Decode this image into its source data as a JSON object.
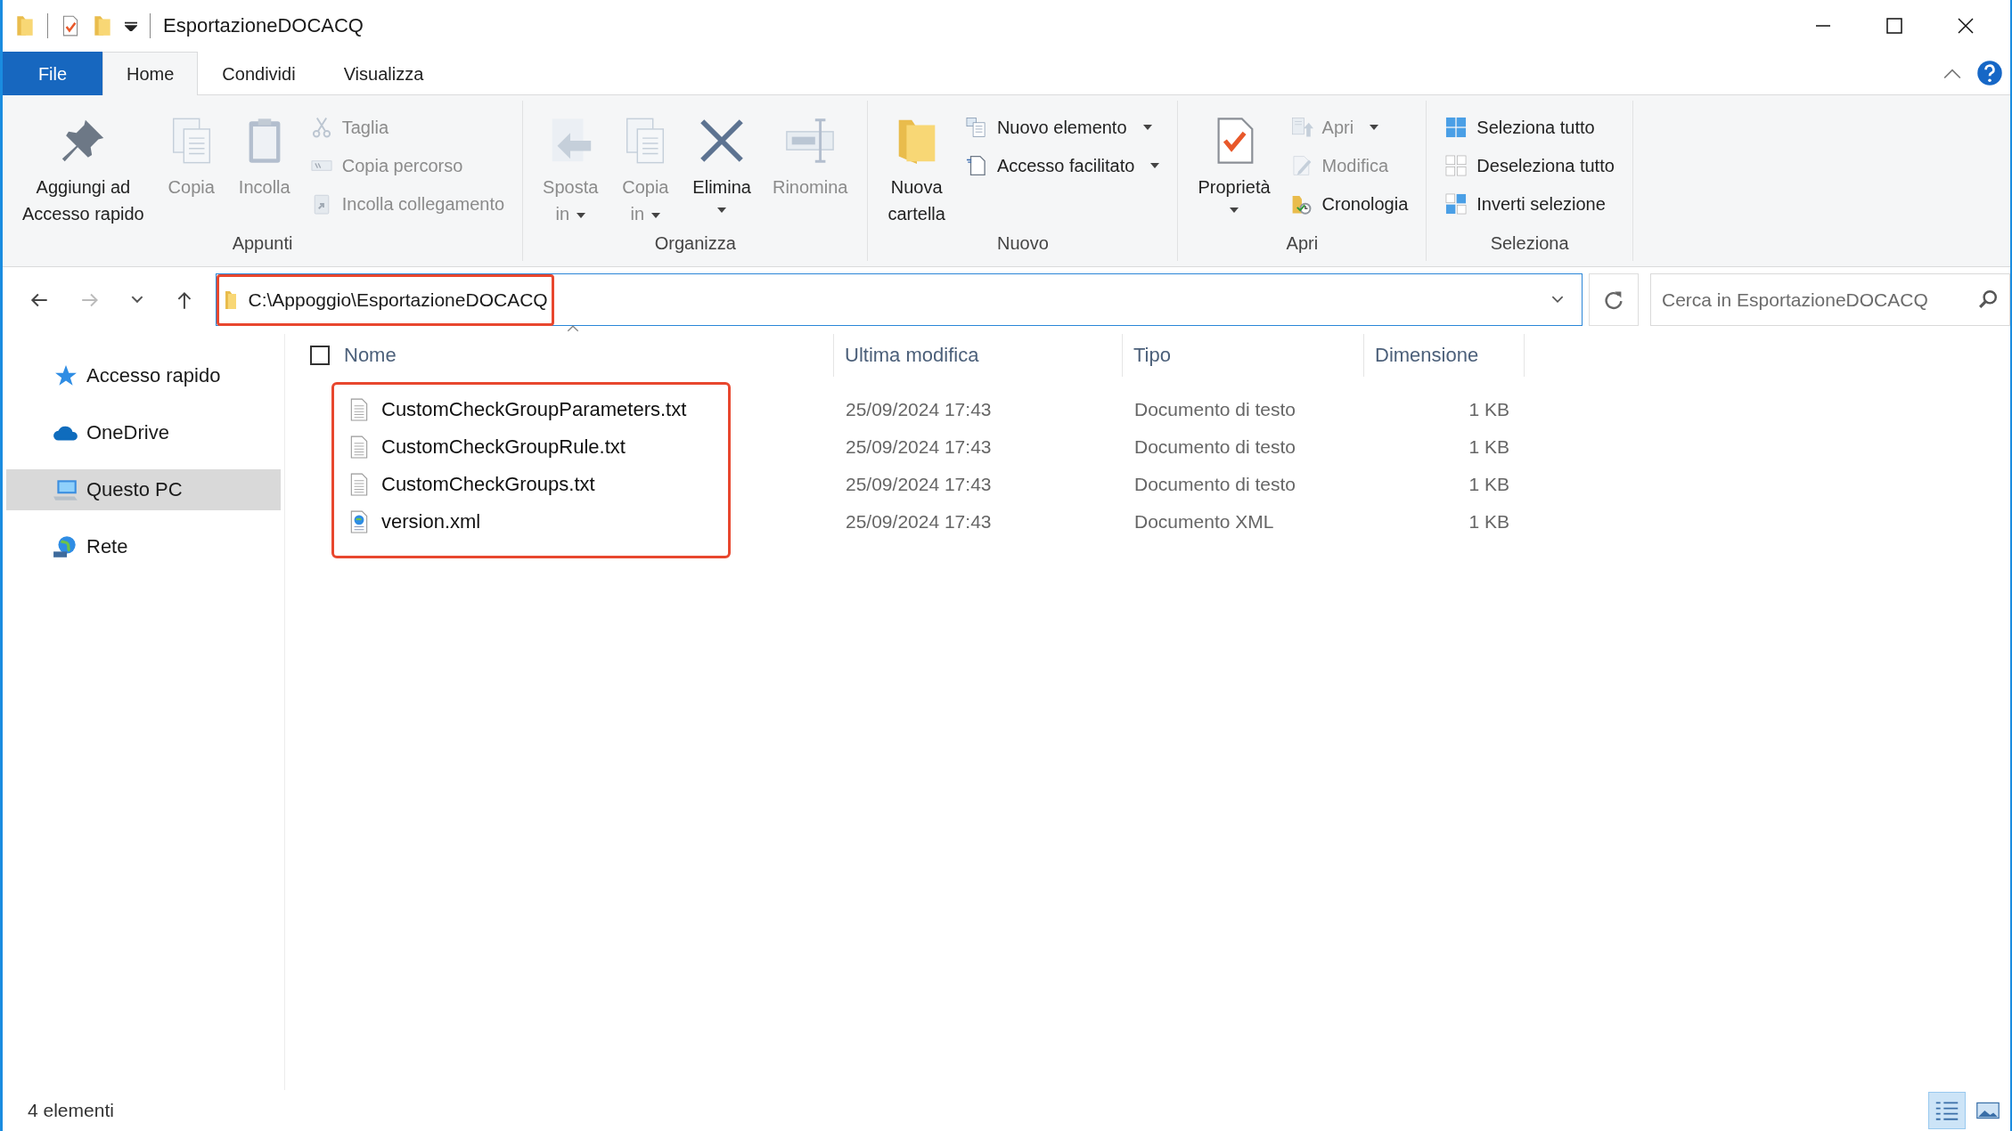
{
  "window": {
    "title": "EsportazioneDOCACQ"
  },
  "tabs": [
    {
      "label": "File",
      "kind": "file",
      "selected": false
    },
    {
      "label": "Home",
      "kind": "tab",
      "selected": true
    },
    {
      "label": "Condividi",
      "kind": "tab",
      "selected": false
    },
    {
      "label": "Visualizza",
      "kind": "tab",
      "selected": false
    }
  ],
  "ribbon": [
    {
      "label": "Appunti",
      "items": [
        {
          "label": "Aggiungi ad\nAccesso rapido",
          "kind": "large",
          "disabled": false
        },
        {
          "label": "Copia",
          "kind": "large",
          "disabled": true
        },
        {
          "label": "Incolla",
          "kind": "large",
          "disabled": true
        },
        {
          "label": "Taglia",
          "kind": "small",
          "disabled": true
        },
        {
          "label": "Copia percorso",
          "kind": "small",
          "disabled": true
        },
        {
          "label": "Incolla collegamento",
          "kind": "small",
          "disabled": true
        }
      ]
    },
    {
      "label": "Organizza",
      "items": [
        {
          "label": "Sposta\nin",
          "kind": "large",
          "disabled": true,
          "dropdown": true
        },
        {
          "label": "Copia\nin",
          "kind": "large",
          "disabled": true,
          "dropdown": true
        },
        {
          "label": "Elimina",
          "kind": "large",
          "disabled": false,
          "dropdown": true,
          "caret_below": true
        },
        {
          "label": "Rinomina",
          "kind": "large",
          "disabled": true
        }
      ]
    },
    {
      "label": "Nuovo",
      "items": [
        {
          "label": "Nuova\ncartella",
          "kind": "large",
          "disabled": false
        },
        {
          "label": "Nuovo elemento",
          "kind": "small",
          "disabled": false,
          "dropdown": true
        },
        {
          "label": "Accesso facilitato",
          "kind": "small",
          "disabled": false,
          "dropdown": true
        }
      ]
    },
    {
      "label": "Apri",
      "items": [
        {
          "label": "Proprietà",
          "kind": "large",
          "disabled": false,
          "dropdown": true,
          "caret_below": true
        },
        {
          "label": "Apri",
          "kind": "small",
          "disabled": true,
          "dropdown": true
        },
        {
          "label": "Modifica",
          "kind": "small",
          "disabled": true
        },
        {
          "label": "Cronologia",
          "kind": "small",
          "disabled": false
        }
      ]
    },
    {
      "label": "Seleziona",
      "items": [
        {
          "label": "Seleziona tutto",
          "kind": "small",
          "disabled": false
        },
        {
          "label": "Deseleziona tutto",
          "kind": "small",
          "disabled": false
        },
        {
          "label": "Inverti selezione",
          "kind": "small",
          "disabled": false
        }
      ]
    }
  ],
  "address_bar": {
    "path": "C:\\Appoggio\\EsportazioneDOCACQ",
    "highlighted": true
  },
  "search": {
    "placeholder": "Cerca in EsportazioneDOCACQ"
  },
  "sidebar": {
    "items": [
      {
        "label": "Accesso rapido",
        "selected": false
      },
      {
        "label": "OneDrive",
        "selected": false
      },
      {
        "label": "Questo PC",
        "selected": true
      },
      {
        "label": "Rete",
        "selected": false
      }
    ]
  },
  "file_list": {
    "select_all": {
      "checked": false
    },
    "columns": [
      "Nome",
      "Ultima modifica",
      "Tipo",
      "Dimensione"
    ],
    "highlighted": true,
    "rows": [
      {
        "name": "CustomCheckGroupParameters.txt",
        "modified": "25/09/2024 17:43",
        "type": "Documento di testo",
        "size": "1 KB",
        "kind": "text"
      },
      {
        "name": "CustomCheckGroupRule.txt",
        "modified": "25/09/2024 17:43",
        "type": "Documento di testo",
        "size": "1 KB",
        "kind": "text"
      },
      {
        "name": "CustomCheckGroups.txt",
        "modified": "25/09/2024 17:43",
        "type": "Documento di testo",
        "size": "1 KB",
        "kind": "text"
      },
      {
        "name": "version.xml",
        "modified": "25/09/2024 17:43",
        "type": "Documento XML",
        "size": "1 KB",
        "kind": "xml"
      }
    ]
  },
  "status_bar": {
    "text": "4 elementi",
    "views": [
      {
        "selected": true
      },
      {
        "selected": false
      }
    ]
  }
}
